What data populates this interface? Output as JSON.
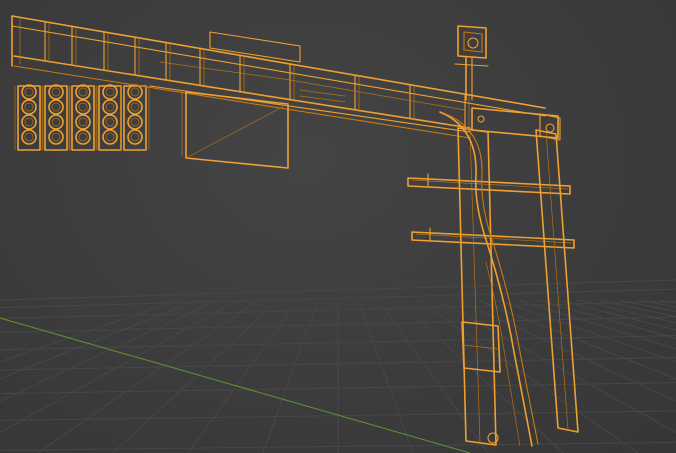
{
  "viewport": {
    "mode": "wireframe",
    "background_color": "#3d3d3d",
    "grid_color": "#474747",
    "x_axis_color": "#9a3b3b",
    "y_axis_color": "#5f8f2e",
    "selection_color": "#f0a030",
    "selection_inner_color": "#c97a14"
  },
  "scene": {
    "object": "overhead-traffic-signal-gantry",
    "selected": true,
    "signal_head_count": 5,
    "lamps_per_head": 4
  }
}
